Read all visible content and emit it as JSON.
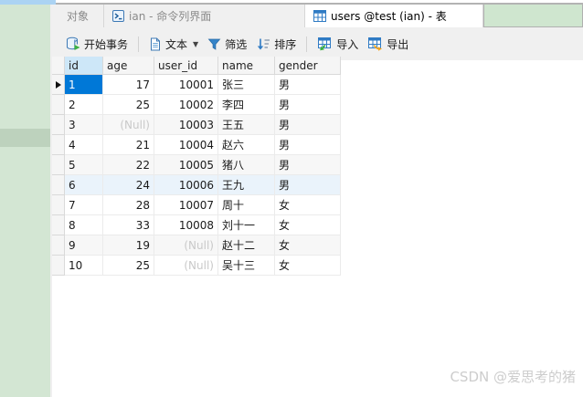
{
  "tabs": [
    {
      "label": "对象",
      "active": false
    },
    {
      "label": "ian - 命令列界面",
      "icon": "terminal-icon",
      "active": false
    },
    {
      "label": "users @test (ian) - 表",
      "icon": "table-icon",
      "active": true
    }
  ],
  "toolbar": {
    "begin_transaction": "开始事务",
    "text": "文本",
    "filter": "筛选",
    "sort": "排序",
    "import": "导入",
    "export": "导出"
  },
  "grid": {
    "columns": [
      "id",
      "age",
      "user_id",
      "name",
      "gender"
    ],
    "selected_cell": {
      "row": 1,
      "column": "id"
    },
    "rows": [
      {
        "id": "1",
        "age": "17",
        "user_id": "10001",
        "name": "张三",
        "gender": "男"
      },
      {
        "id": "2",
        "age": "25",
        "user_id": "10002",
        "name": "李四",
        "gender": "男"
      },
      {
        "id": "3",
        "age": "(Null)",
        "user_id": "10003",
        "name": "王五",
        "gender": "男"
      },
      {
        "id": "4",
        "age": "21",
        "user_id": "10004",
        "name": "赵六",
        "gender": "男"
      },
      {
        "id": "5",
        "age": "22",
        "user_id": "10005",
        "name": "猪八",
        "gender": "男"
      },
      {
        "id": "6",
        "age": "24",
        "user_id": "10006",
        "name": "王九",
        "gender": "男"
      },
      {
        "id": "7",
        "age": "28",
        "user_id": "10007",
        "name": "周十",
        "gender": "女"
      },
      {
        "id": "8",
        "age": "33",
        "user_id": "10008",
        "name": "刘十一",
        "gender": "女"
      },
      {
        "id": "9",
        "age": "19",
        "user_id": "(Null)",
        "name": "赵十二",
        "gender": "女"
      },
      {
        "id": "10",
        "age": "25",
        "user_id": "(Null)",
        "name": "吴十三",
        "gender": "女"
      }
    ]
  },
  "watermark": "CSDN @爱思考的猪",
  "colors": {
    "selection_blue": "#0078d7",
    "selected_header": "#cde7f8",
    "toolbar_bg": "#f0f0f0",
    "green_window": "#d3e6d3",
    "icon_blue": "#2f7bc4",
    "icon_green": "#3cb043",
    "icon_orange": "#f5a623"
  }
}
